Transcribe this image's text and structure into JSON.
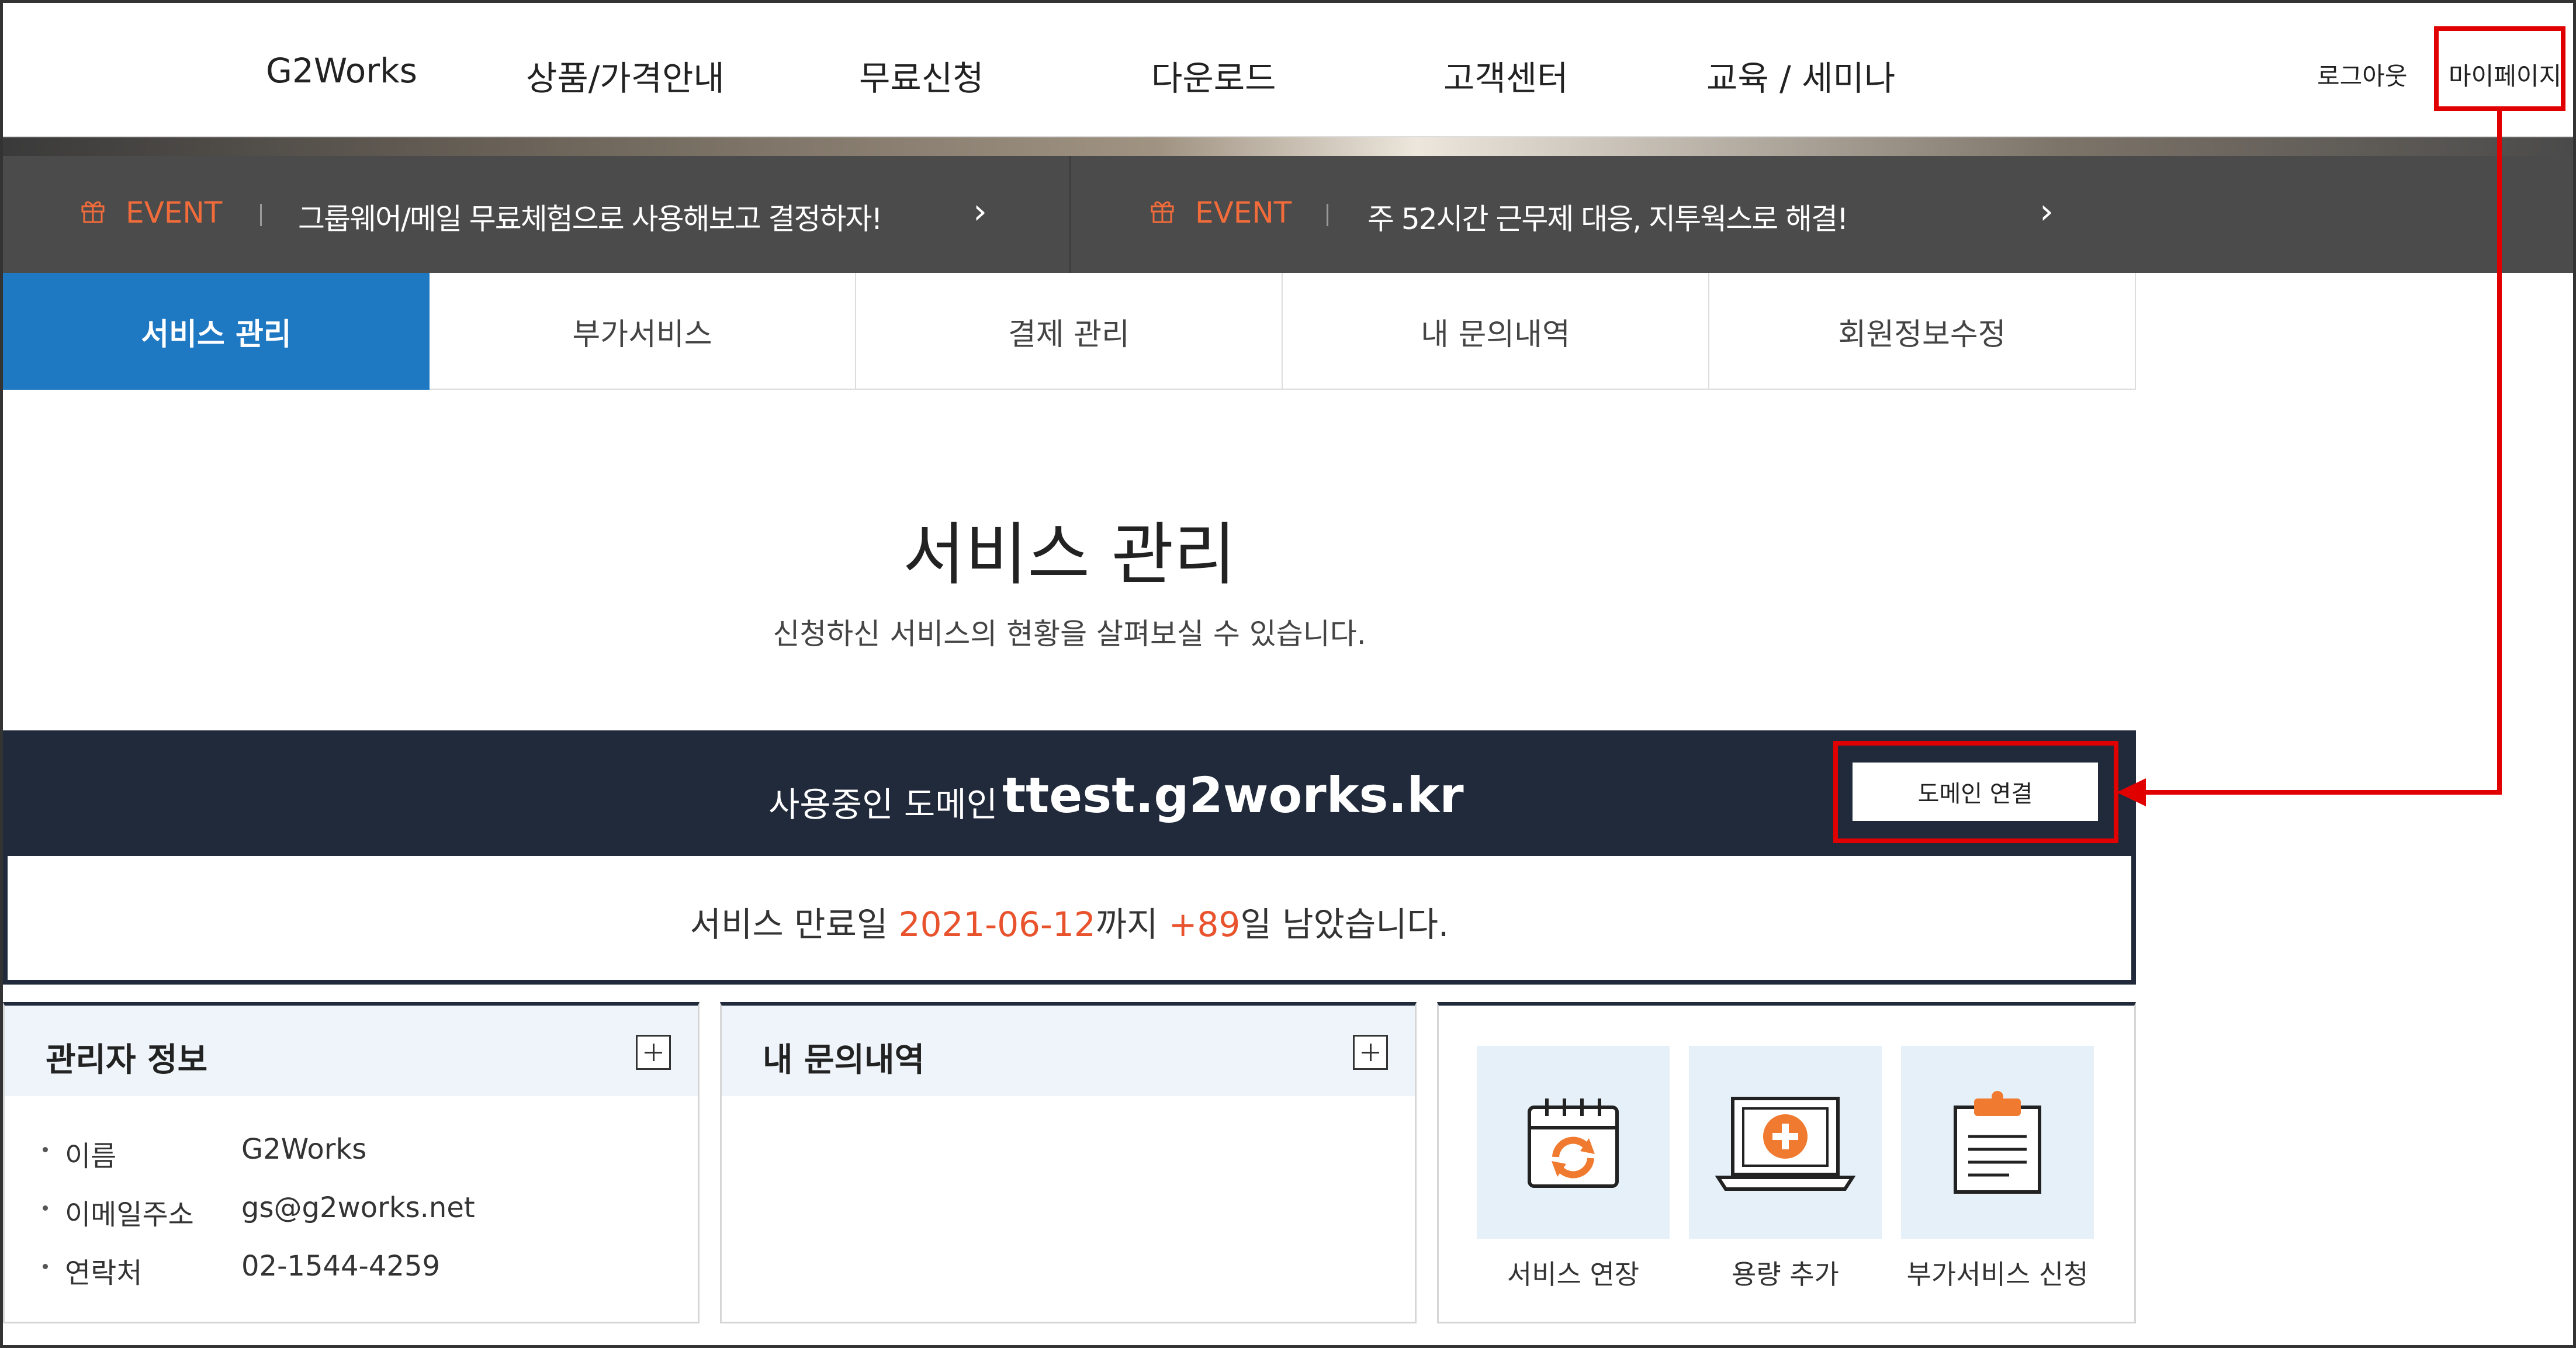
{
  "nav": {
    "brand": "G2Works",
    "items": [
      "상품/가격안내",
      "무료신청",
      "다운로드",
      "고객센터",
      "교육 / 세미나"
    ],
    "logout": "로그아웃",
    "mypage": "마이페이지"
  },
  "events": [
    {
      "tag": "EVENT",
      "text": "그룹웨어/메일 무료체험으로 사용해보고 결정하자!",
      "arrow": "›"
    },
    {
      "tag": "EVENT",
      "text": "주 52시간 근무제 대응, 지투웍스로 해결!",
      "arrow": "›"
    }
  ],
  "tabs": [
    "서비스 관리",
    "부가서비스",
    "결제 관리",
    "내 문의내역",
    "회원정보수정"
  ],
  "page": {
    "title": "서비스 관리",
    "subtitle": "신청하신 서비스의 현황을 살펴보실 수 있습니다."
  },
  "domain": {
    "label": "사용중인 도메인",
    "value": "ttest.g2works.kr",
    "connect_button": "도메인 연결",
    "expiry_prefix": "서비스 만료일 ",
    "expiry_date": "2021-06-12",
    "expiry_mid": "까지 ",
    "days_left": "+89",
    "expiry_suffix": "일 남았습니다."
  },
  "admin_panel": {
    "title": "관리자 정보",
    "rows": [
      {
        "label": "이름",
        "value": "G2Works"
      },
      {
        "label": "이메일주소",
        "value": "gs@g2works.net"
      },
      {
        "label": "연락처",
        "value": "02-1544-4259"
      }
    ]
  },
  "inquiry_panel": {
    "title": "내 문의내역"
  },
  "quick_actions": [
    {
      "label": "서비스 연장",
      "icon": "calendar-renew-icon"
    },
    {
      "label": "용량 추가",
      "icon": "laptop-add-icon"
    },
    {
      "label": "부가서비스 신청",
      "icon": "clipboard-icon"
    }
  ],
  "colors": {
    "accent_blue": "#1e78c2",
    "dark_navy": "#212a3b",
    "event_orange": "#f26b3a",
    "highlight_red": "#e00000"
  }
}
